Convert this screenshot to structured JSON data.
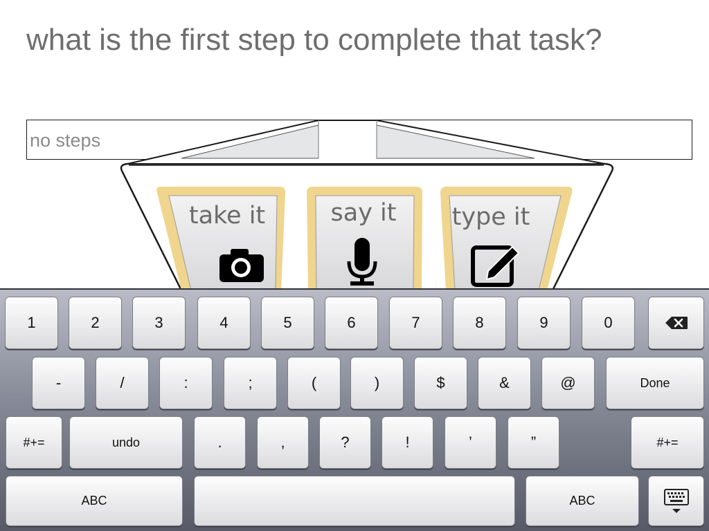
{
  "question": "what is the first step to complete that task?",
  "answer_field": {
    "value": "no steps"
  },
  "options": [
    {
      "label": "take it",
      "icon": "camera-icon"
    },
    {
      "label": "say it",
      "icon": "microphone-icon"
    },
    {
      "label": "type it",
      "icon": "edit-icon"
    }
  ],
  "colors": {
    "option_border": "#f0d58e",
    "question_text": "#6e6e6e"
  },
  "keyboard": {
    "row1": [
      "1",
      "2",
      "3",
      "4",
      "5",
      "6",
      "7",
      "8",
      "9",
      "0"
    ],
    "delete_icon": "backspace-icon",
    "row2": [
      "-",
      "/",
      ":",
      ";",
      "(",
      ")",
      "$",
      "&",
      "@"
    ],
    "done": "Done",
    "shift_left": "#+=",
    "undo": "undo",
    "row3": [
      ".",
      ",",
      "?",
      "!",
      "’",
      "”"
    ],
    "shift_right": "#+=",
    "abc_left": "ABC",
    "abc_right": "ABC",
    "hide_icon": "keyboard-hide-icon"
  }
}
